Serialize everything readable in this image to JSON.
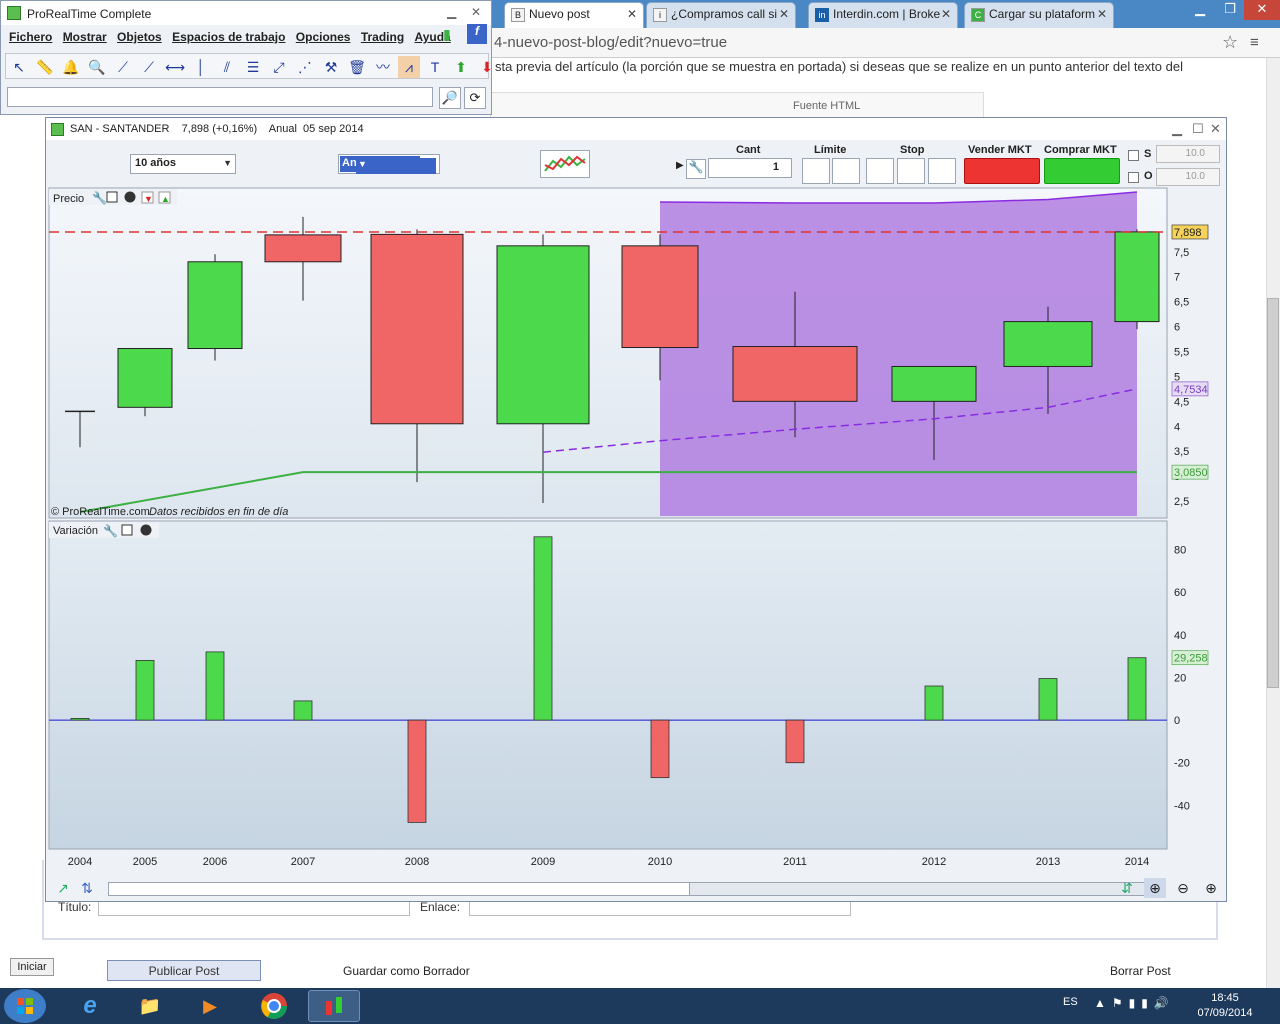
{
  "browser": {
    "tabs": [
      {
        "label": "Nuevo post",
        "favicon": "B",
        "active": true
      },
      {
        "label": "¿Compramos call si",
        "favicon": "i"
      },
      {
        "label": "Interdin.com | Broke",
        "favicon": "in"
      },
      {
        "label": "Cargar su plataform",
        "favicon": "C"
      }
    ],
    "url": "4-nuevo-post-blog/edit?nuevo=true",
    "page_text": "sta previa del artículo (la porción que se muestra en portada) si deseas que se realize en un punto anterior del texto del",
    "editor_source_label": "Fuente HTML",
    "form": {
      "titulo_label": "Título:",
      "enlace_label": "Enlace:"
    },
    "iniciar_label": "Iniciar",
    "publicar_label": "Publicar Post",
    "guardar_label": "Guardar como Borrador",
    "borrar_label": "Borrar Post"
  },
  "prt": {
    "title": "ProRealTime Complete",
    "menu": [
      "Fichero",
      "Mostrar",
      "Objetos",
      "Espacios de trabajo",
      "Opciones",
      "Trading",
      "Ayuda"
    ],
    "search_value": ""
  },
  "chart_window": {
    "title": "SAN - SANTANDER    7,898 (+0,16%)    Anual  05 sep 2014",
    "period": "10 años",
    "timeframe": "Anual",
    "order": {
      "qty_label": "Cant",
      "qty": "1",
      "limit_label": "Límite",
      "stop_label": "Stop",
      "sell_label": "Vender MKT",
      "buy_label": "Comprar MKT",
      "s_label": "S",
      "o_label": "O",
      "s_value": "10.0",
      "o_value": "10.0"
    },
    "price_panel_label": "Precio",
    "variation_panel_label": "Variación",
    "copyright": "© ProRealTime.com",
    "data_note": "Datos recibidos en fin de día"
  },
  "chart_data": [
    {
      "type": "candlestick",
      "title": "Precio",
      "x": [
        "2004",
        "2005",
        "2006",
        "2007",
        "2008",
        "2009",
        "2010",
        "2011",
        "2012",
        "2013",
        "2014"
      ],
      "open": [
        4.3,
        4.38,
        5.56,
        7.84,
        7.85,
        4.05,
        7.62,
        5.6,
        4.5,
        5.2,
        6.1
      ],
      "high": [
        4.3,
        5.56,
        7.45,
        8.2,
        7.95,
        7.85,
        7.85,
        6.7,
        5.2,
        6.4,
        7.95
      ],
      "low": [
        3.58,
        4.2,
        5.32,
        6.52,
        2.88,
        2.46,
        4.92,
        3.78,
        3.32,
        4.25,
        5.95
      ],
      "close": [
        4.3,
        5.56,
        7.3,
        7.3,
        4.05,
        7.62,
        5.58,
        4.5,
        5.2,
        6.1,
        7.9
      ],
      "ylim": [
        2.2,
        8.7
      ],
      "y_ticks": [
        2.5,
        3,
        3.5,
        4,
        4.5,
        5,
        5.5,
        6,
        6.5,
        7,
        7.5
      ],
      "overlays": [
        {
          "name": "last",
          "value": 7.898,
          "label": "7,898",
          "style": "dashed",
          "color": "#dd3333"
        },
        {
          "name": "moving-average",
          "label": "4,7534",
          "color": "#8a2be2",
          "style": "dashed",
          "x": [
            "2009",
            "2010",
            "2011",
            "2012",
            "2013",
            "2014"
          ],
          "values": [
            3.48,
            3.71,
            3.94,
            4.15,
            4.38,
            4.75
          ]
        },
        {
          "name": "support",
          "label": "3,0850",
          "color": "#3cb043",
          "x": [
            "2004",
            "2007",
            "2014"
          ],
          "values": [
            2.28,
            3.08,
            3.08
          ]
        },
        {
          "name": "band-top",
          "color": "#8a2be2",
          "x": [
            "2010",
            "2011",
            "2012",
            "2013",
            "2014"
          ],
          "values": [
            8.5,
            8.48,
            8.48,
            8.55,
            8.7
          ]
        }
      ],
      "shaded_region": {
        "from": "2010",
        "to": "2014",
        "color": "#b07ee0"
      },
      "colors": {
        "up": "#4cd94c",
        "down": "#f06565"
      }
    },
    {
      "type": "bar",
      "title": "Variación",
      "x": [
        "2004",
        "2005",
        "2006",
        "2007",
        "2008",
        "2009",
        "2010",
        "2011",
        "2012",
        "2013",
        "2014"
      ],
      "values": [
        0.8,
        28,
        32,
        9,
        -48,
        86,
        -27,
        -20,
        16,
        19.5,
        29.258
      ],
      "last_label": "29,258",
      "ylim": [
        -60,
        92
      ],
      "y_ticks": [
        -40,
        -20,
        0,
        20,
        40,
        60,
        80
      ],
      "colors": {
        "up": "#4cd94c",
        "down": "#f06565"
      }
    }
  ],
  "taskbar": {
    "lang": "ES",
    "time": "18:45",
    "date": "07/09/2014"
  }
}
